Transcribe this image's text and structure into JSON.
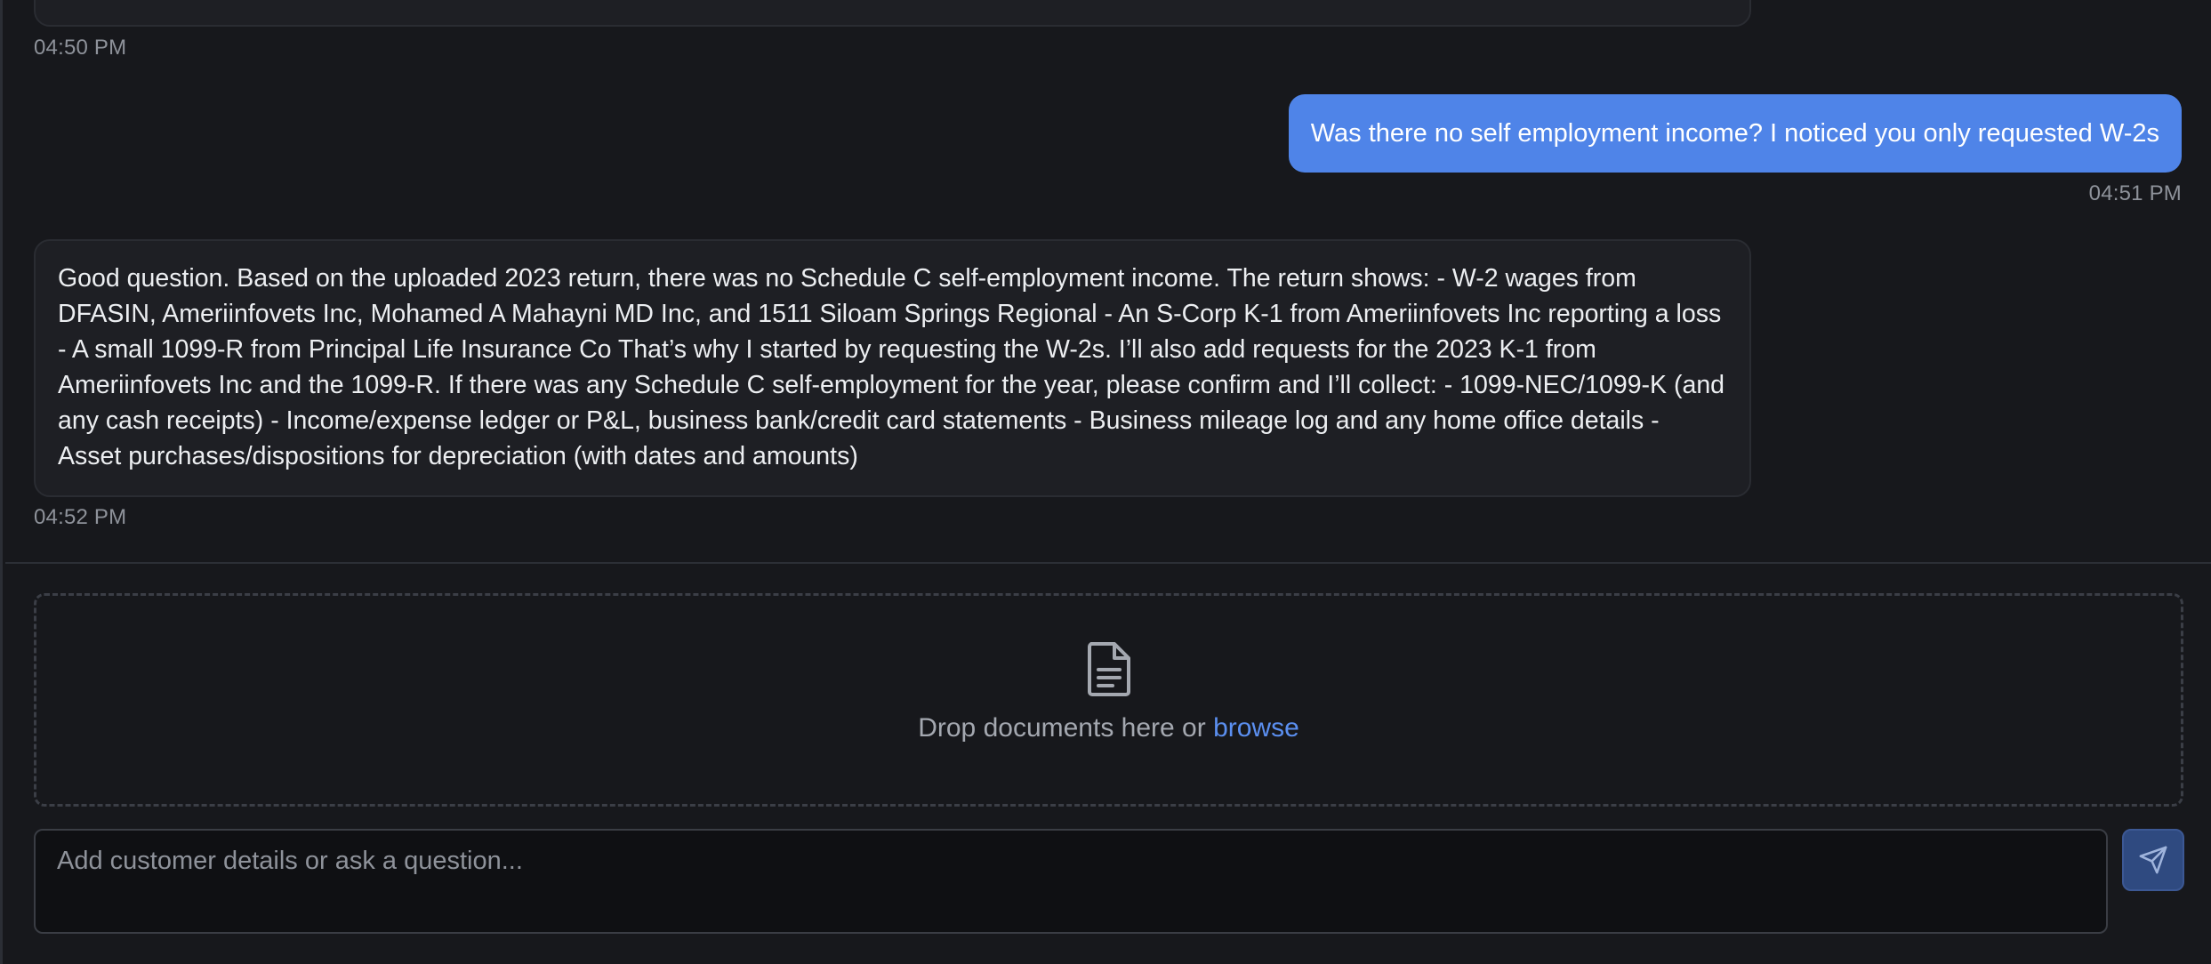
{
  "messages": [
    {
      "role": "assistant",
      "timestamp": "04:50 PM"
    },
    {
      "role": "user",
      "text": "Was there no self employment income? I noticed you only requested W-2s",
      "timestamp": "04:51 PM"
    },
    {
      "role": "assistant",
      "text": "Good question. Based on the uploaded 2023 return, there was no Schedule C self-employment income. The return shows: - W-2 wages from DFASIN, Ameriinfovets Inc, Mohamed A Mahayni MD Inc, and 1511 Siloam Springs Regional - An S-Corp K-1 from Ameriinfovets Inc reporting a loss - A small 1099-R from Principal Life Insurance Co That’s why I started by requesting the W-2s. I’ll also add requests for the 2023 K-1 from Ameriinfovets Inc and the 1099-R. If there was any Schedule C self-employment for the year, please confirm and I’ll collect: - 1099-NEC/1099-K (and any cash receipts) - Income/expense ledger or P&L, business bank/credit card statements - Business mileage log and any home office details - Asset purchases/dispositions for depreciation (with dates and amounts)",
      "timestamp": "04:52 PM"
    }
  ],
  "dropzone": {
    "icon": "document-icon",
    "prompt": "Drop documents here or ",
    "browse_label": "browse"
  },
  "composer": {
    "placeholder": "Add customer details or ask a question...",
    "value": "",
    "send_icon": "send-icon"
  },
  "colors": {
    "background": "#17181c",
    "user_bubble": "#4f84e8",
    "assistant_bubble": "#1e1f24",
    "link": "#5b8ff0",
    "send_button": "#2f4a80"
  }
}
